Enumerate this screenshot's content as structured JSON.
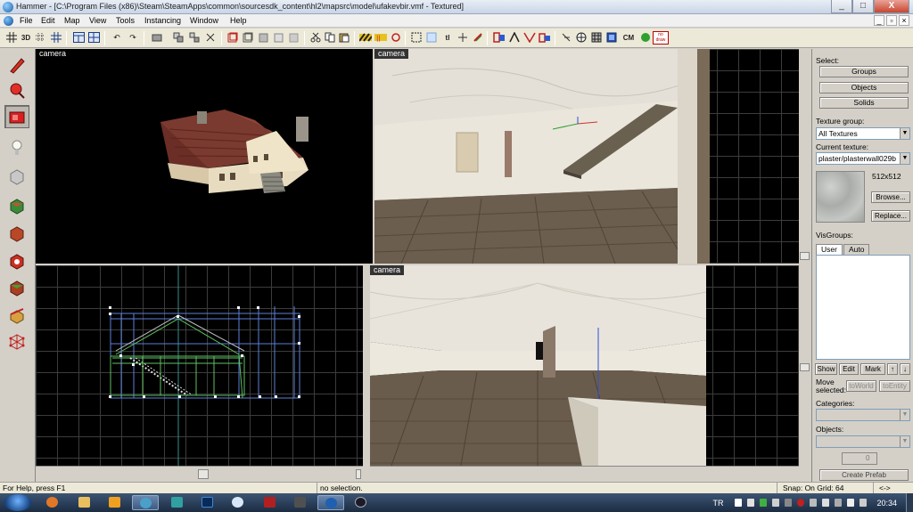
{
  "window": {
    "title": "Hammer - [C:\\Program Files (x86)\\Steam\\SteamApps\\common\\sourcesdk_content\\hl2\\mapsrc\\model\\ufakevbir.vmf - Textured]",
    "minimize": "_",
    "maximize": "□",
    "close": "X"
  },
  "menu": {
    "items": [
      "File",
      "Edit",
      "Map",
      "View",
      "Tools",
      "Instancing",
      "Window",
      "Help"
    ],
    "mdi_minimize": "_",
    "mdi_restore": "▫",
    "mdi_close": "×"
  },
  "toolbar": {
    "redo_glyph": "↷",
    "undo_glyph": "↶",
    "cm_label": "CM",
    "grid3d_label": "3D",
    "tl_label": "tl",
    "nodraw_label": "no draw"
  },
  "viewports": {
    "top_left": {
      "label": "camera"
    },
    "top_right": {
      "label": "camera"
    },
    "bottom_right": {
      "label": "camera"
    }
  },
  "right_panel": {
    "select_label": "Select:",
    "groups_button": "Groups",
    "objects_button": "Objects",
    "solids_button": "Solids",
    "texture_group_label": "Texture group:",
    "texture_group_value": "All Textures",
    "current_texture_label": "Current texture:",
    "current_texture_value": "plaster/plasterwall029b",
    "texture_size": "512x512",
    "browse_button": "Browse...",
    "replace_button": "Replace...",
    "visgroups_label": "VisGroups:",
    "tab_user": "User",
    "tab_auto": "Auto",
    "show_button": "Show",
    "edit_button": "Edit",
    "mark_button": "Mark",
    "up_button": "↑",
    "down_button": "↓",
    "move_selected_label": "Move selected:",
    "to_world_button": "toWorld",
    "to_entity_button": "toEntity",
    "categories_label": "Categories:",
    "objects_label": "Objects:",
    "spin_value": "0",
    "create_prefab_button": "Create Prefab"
  },
  "statusbar": {
    "help": "For Help, press F1",
    "selection": "no selection.",
    "snap": "Snap: On Grid: 64",
    "arrows": "<->"
  },
  "taskbar": {
    "language": "TR",
    "clock": "20:34"
  },
  "colors": {
    "accent": "#1f5fa8",
    "viewport_bg": "#000000",
    "grid_line": "#3c3c3c",
    "wire_green": "#5fbf5f",
    "wire_blue": "#5c7fd8"
  }
}
